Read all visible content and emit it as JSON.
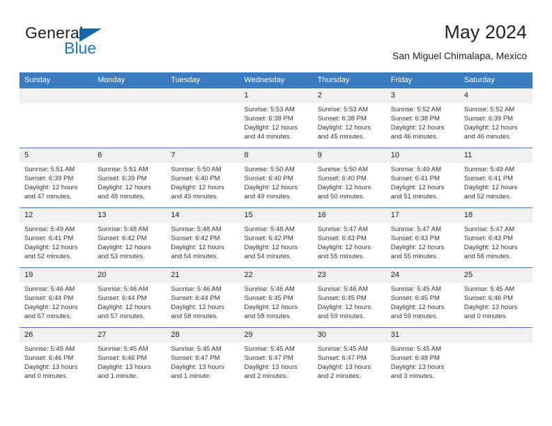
{
  "brand": {
    "name_part1": "General",
    "name_part2": "Blue"
  },
  "header": {
    "title": "May 2024",
    "subtitle": "San Miguel Chimalapa, Mexico"
  },
  "colors": {
    "header_blue": "#3a7bbf",
    "logo_blue": "#1577c4",
    "daynum_band": "#f0f0f0"
  },
  "weekdays": [
    "Sunday",
    "Monday",
    "Tuesday",
    "Wednesday",
    "Thursday",
    "Friday",
    "Saturday"
  ],
  "weeks": [
    [
      {
        "day": "",
        "lines": [
          "",
          "",
          "",
          ""
        ]
      },
      {
        "day": "",
        "lines": [
          "",
          "",
          "",
          ""
        ]
      },
      {
        "day": "",
        "lines": [
          "",
          "",
          "",
          ""
        ]
      },
      {
        "day": "1",
        "lines": [
          "Sunrise: 5:53 AM",
          "Sunset: 6:38 PM",
          "Daylight: 12 hours",
          "and 44 minutes."
        ]
      },
      {
        "day": "2",
        "lines": [
          "Sunrise: 5:53 AM",
          "Sunset: 6:38 PM",
          "Daylight: 12 hours",
          "and 45 minutes."
        ]
      },
      {
        "day": "3",
        "lines": [
          "Sunrise: 5:52 AM",
          "Sunset: 6:38 PM",
          "Daylight: 12 hours",
          "and 46 minutes."
        ]
      },
      {
        "day": "4",
        "lines": [
          "Sunrise: 5:52 AM",
          "Sunset: 6:39 PM",
          "Daylight: 12 hours",
          "and 46 minutes."
        ]
      }
    ],
    [
      {
        "day": "5",
        "lines": [
          "Sunrise: 5:51 AM",
          "Sunset: 6:39 PM",
          "Daylight: 12 hours",
          "and 47 minutes."
        ]
      },
      {
        "day": "6",
        "lines": [
          "Sunrise: 5:51 AM",
          "Sunset: 6:39 PM",
          "Daylight: 12 hours",
          "and 48 minutes."
        ]
      },
      {
        "day": "7",
        "lines": [
          "Sunrise: 5:50 AM",
          "Sunset: 6:40 PM",
          "Daylight: 12 hours",
          "and 49 minutes."
        ]
      },
      {
        "day": "8",
        "lines": [
          "Sunrise: 5:50 AM",
          "Sunset: 6:40 PM",
          "Daylight: 12 hours",
          "and 49 minutes."
        ]
      },
      {
        "day": "9",
        "lines": [
          "Sunrise: 5:50 AM",
          "Sunset: 6:40 PM",
          "Daylight: 12 hours",
          "and 50 minutes."
        ]
      },
      {
        "day": "10",
        "lines": [
          "Sunrise: 5:49 AM",
          "Sunset: 6:41 PM",
          "Daylight: 12 hours",
          "and 51 minutes."
        ]
      },
      {
        "day": "11",
        "lines": [
          "Sunrise: 5:49 AM",
          "Sunset: 6:41 PM",
          "Daylight: 12 hours",
          "and 52 minutes."
        ]
      }
    ],
    [
      {
        "day": "12",
        "lines": [
          "Sunrise: 5:49 AM",
          "Sunset: 6:41 PM",
          "Daylight: 12 hours",
          "and 52 minutes."
        ]
      },
      {
        "day": "13",
        "lines": [
          "Sunrise: 5:48 AM",
          "Sunset: 6:42 PM",
          "Daylight: 12 hours",
          "and 53 minutes."
        ]
      },
      {
        "day": "14",
        "lines": [
          "Sunrise: 5:48 AM",
          "Sunset: 6:42 PM",
          "Daylight: 12 hours",
          "and 54 minutes."
        ]
      },
      {
        "day": "15",
        "lines": [
          "Sunrise: 5:48 AM",
          "Sunset: 6:42 PM",
          "Daylight: 12 hours",
          "and 54 minutes."
        ]
      },
      {
        "day": "16",
        "lines": [
          "Sunrise: 5:47 AM",
          "Sunset: 6:43 PM",
          "Daylight: 12 hours",
          "and 55 minutes."
        ]
      },
      {
        "day": "17",
        "lines": [
          "Sunrise: 5:47 AM",
          "Sunset: 6:43 PM",
          "Daylight: 12 hours",
          "and 55 minutes."
        ]
      },
      {
        "day": "18",
        "lines": [
          "Sunrise: 5:47 AM",
          "Sunset: 6:43 PM",
          "Daylight: 12 hours",
          "and 56 minutes."
        ]
      }
    ],
    [
      {
        "day": "19",
        "lines": [
          "Sunrise: 5:46 AM",
          "Sunset: 6:44 PM",
          "Daylight: 12 hours",
          "and 57 minutes."
        ]
      },
      {
        "day": "20",
        "lines": [
          "Sunrise: 5:46 AM",
          "Sunset: 6:44 PM",
          "Daylight: 12 hours",
          "and 57 minutes."
        ]
      },
      {
        "day": "21",
        "lines": [
          "Sunrise: 5:46 AM",
          "Sunset: 6:44 PM",
          "Daylight: 12 hours",
          "and 58 minutes."
        ]
      },
      {
        "day": "22",
        "lines": [
          "Sunrise: 5:46 AM",
          "Sunset: 6:45 PM",
          "Daylight: 12 hours",
          "and 58 minutes."
        ]
      },
      {
        "day": "23",
        "lines": [
          "Sunrise: 5:46 AM",
          "Sunset: 6:45 PM",
          "Daylight: 12 hours",
          "and 59 minutes."
        ]
      },
      {
        "day": "24",
        "lines": [
          "Sunrise: 5:45 AM",
          "Sunset: 6:45 PM",
          "Daylight: 12 hours",
          "and 59 minutes."
        ]
      },
      {
        "day": "25",
        "lines": [
          "Sunrise: 5:45 AM",
          "Sunset: 6:46 PM",
          "Daylight: 13 hours",
          "and 0 minutes."
        ]
      }
    ],
    [
      {
        "day": "26",
        "lines": [
          "Sunrise: 5:45 AM",
          "Sunset: 6:46 PM",
          "Daylight: 13 hours",
          "and 0 minutes."
        ]
      },
      {
        "day": "27",
        "lines": [
          "Sunrise: 5:45 AM",
          "Sunset: 6:46 PM",
          "Daylight: 13 hours",
          "and 1 minute."
        ]
      },
      {
        "day": "28",
        "lines": [
          "Sunrise: 5:45 AM",
          "Sunset: 6:47 PM",
          "Daylight: 13 hours",
          "and 1 minute."
        ]
      },
      {
        "day": "29",
        "lines": [
          "Sunrise: 5:45 AM",
          "Sunset: 6:47 PM",
          "Daylight: 13 hours",
          "and 2 minutes."
        ]
      },
      {
        "day": "30",
        "lines": [
          "Sunrise: 5:45 AM",
          "Sunset: 6:47 PM",
          "Daylight: 13 hours",
          "and 2 minutes."
        ]
      },
      {
        "day": "31",
        "lines": [
          "Sunrise: 5:45 AM",
          "Sunset: 6:48 PM",
          "Daylight: 13 hours",
          "and 3 minutes."
        ]
      },
      {
        "day": "",
        "lines": [
          "",
          "",
          "",
          ""
        ]
      }
    ]
  ]
}
